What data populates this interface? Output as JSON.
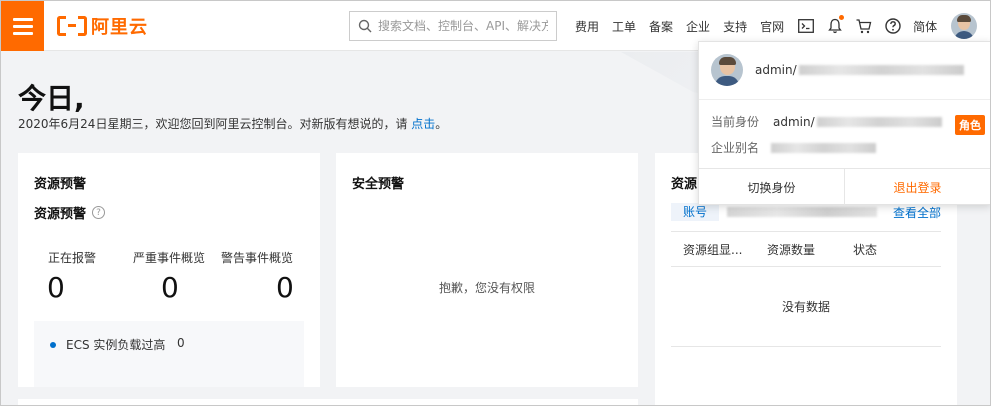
{
  "header": {
    "logo_text": "阿里云",
    "search_placeholder": "搜索文档、控制台、API、解决方",
    "nav": [
      "费用",
      "工单",
      "备案",
      "企业",
      "支持",
      "官网"
    ],
    "lang": "简体"
  },
  "welcome": {
    "greeting": "今日,",
    "message": "2020年6月24日星期三，欢迎您回到阿里云控制台。对新版有想说的，请",
    "link": "点击",
    "period": "。"
  },
  "resource_alarm": {
    "title": "资源预警",
    "subtitle": "资源预警",
    "stats": [
      {
        "label": "正在报警",
        "value": "0"
      },
      {
        "label": "严重事件概览",
        "value": "0"
      },
      {
        "label": "警告事件概览",
        "value": "0"
      }
    ],
    "alarm_item": {
      "label": "ECS 实例负载过高",
      "count": "0"
    }
  },
  "security_alarm": {
    "title": "安全预警",
    "message": "抱歉，您没有权限"
  },
  "resource_panel": {
    "title": "资源",
    "account_label": "账号",
    "view_all": "查看全部",
    "columns": [
      "资源组显...",
      "资源数量",
      "状态"
    ],
    "empty": "没有数据"
  },
  "user_menu": {
    "username_prefix": "admin/",
    "identity_label": "当前身份",
    "identity_prefix": "admin/",
    "role_tag": "角色",
    "alias_label": "企业别名",
    "switch_identity": "切换身份",
    "logout": "退出登录"
  },
  "colors": {
    "brand": "#ff6a00",
    "link": "#0070cc"
  }
}
